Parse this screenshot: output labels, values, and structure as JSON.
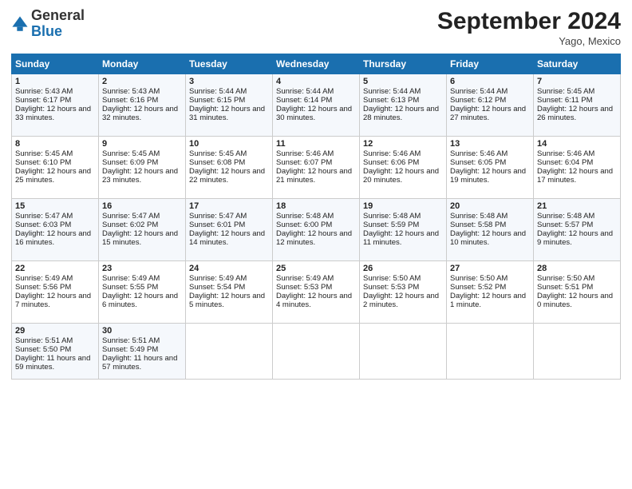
{
  "logo": {
    "general": "General",
    "blue": "Blue"
  },
  "title": "September 2024",
  "location": "Yago, Mexico",
  "days_header": [
    "Sunday",
    "Monday",
    "Tuesday",
    "Wednesday",
    "Thursday",
    "Friday",
    "Saturday"
  ],
  "weeks": [
    [
      {
        "day": "1",
        "info": "Sunrise: 5:43 AM\nSunset: 6:17 PM\nDaylight: 12 hours and 33 minutes."
      },
      {
        "day": "2",
        "info": "Sunrise: 5:43 AM\nSunset: 6:16 PM\nDaylight: 12 hours and 32 minutes."
      },
      {
        "day": "3",
        "info": "Sunrise: 5:44 AM\nSunset: 6:15 PM\nDaylight: 12 hours and 31 minutes."
      },
      {
        "day": "4",
        "info": "Sunrise: 5:44 AM\nSunset: 6:14 PM\nDaylight: 12 hours and 30 minutes."
      },
      {
        "day": "5",
        "info": "Sunrise: 5:44 AM\nSunset: 6:13 PM\nDaylight: 12 hours and 28 minutes."
      },
      {
        "day": "6",
        "info": "Sunrise: 5:44 AM\nSunset: 6:12 PM\nDaylight: 12 hours and 27 minutes."
      },
      {
        "day": "7",
        "info": "Sunrise: 5:45 AM\nSunset: 6:11 PM\nDaylight: 12 hours and 26 minutes."
      }
    ],
    [
      {
        "day": "8",
        "info": "Sunrise: 5:45 AM\nSunset: 6:10 PM\nDaylight: 12 hours and 25 minutes."
      },
      {
        "day": "9",
        "info": "Sunrise: 5:45 AM\nSunset: 6:09 PM\nDaylight: 12 hours and 23 minutes."
      },
      {
        "day": "10",
        "info": "Sunrise: 5:45 AM\nSunset: 6:08 PM\nDaylight: 12 hours and 22 minutes."
      },
      {
        "day": "11",
        "info": "Sunrise: 5:46 AM\nSunset: 6:07 PM\nDaylight: 12 hours and 21 minutes."
      },
      {
        "day": "12",
        "info": "Sunrise: 5:46 AM\nSunset: 6:06 PM\nDaylight: 12 hours and 20 minutes."
      },
      {
        "day": "13",
        "info": "Sunrise: 5:46 AM\nSunset: 6:05 PM\nDaylight: 12 hours and 19 minutes."
      },
      {
        "day": "14",
        "info": "Sunrise: 5:46 AM\nSunset: 6:04 PM\nDaylight: 12 hours and 17 minutes."
      }
    ],
    [
      {
        "day": "15",
        "info": "Sunrise: 5:47 AM\nSunset: 6:03 PM\nDaylight: 12 hours and 16 minutes."
      },
      {
        "day": "16",
        "info": "Sunrise: 5:47 AM\nSunset: 6:02 PM\nDaylight: 12 hours and 15 minutes."
      },
      {
        "day": "17",
        "info": "Sunrise: 5:47 AM\nSunset: 6:01 PM\nDaylight: 12 hours and 14 minutes."
      },
      {
        "day": "18",
        "info": "Sunrise: 5:48 AM\nSunset: 6:00 PM\nDaylight: 12 hours and 12 minutes."
      },
      {
        "day": "19",
        "info": "Sunrise: 5:48 AM\nSunset: 5:59 PM\nDaylight: 12 hours and 11 minutes."
      },
      {
        "day": "20",
        "info": "Sunrise: 5:48 AM\nSunset: 5:58 PM\nDaylight: 12 hours and 10 minutes."
      },
      {
        "day": "21",
        "info": "Sunrise: 5:48 AM\nSunset: 5:57 PM\nDaylight: 12 hours and 9 minutes."
      }
    ],
    [
      {
        "day": "22",
        "info": "Sunrise: 5:49 AM\nSunset: 5:56 PM\nDaylight: 12 hours and 7 minutes."
      },
      {
        "day": "23",
        "info": "Sunrise: 5:49 AM\nSunset: 5:55 PM\nDaylight: 12 hours and 6 minutes."
      },
      {
        "day": "24",
        "info": "Sunrise: 5:49 AM\nSunset: 5:54 PM\nDaylight: 12 hours and 5 minutes."
      },
      {
        "day": "25",
        "info": "Sunrise: 5:49 AM\nSunset: 5:53 PM\nDaylight: 12 hours and 4 minutes."
      },
      {
        "day": "26",
        "info": "Sunrise: 5:50 AM\nSunset: 5:53 PM\nDaylight: 12 hours and 2 minutes."
      },
      {
        "day": "27",
        "info": "Sunrise: 5:50 AM\nSunset: 5:52 PM\nDaylight: 12 hours and 1 minute."
      },
      {
        "day": "28",
        "info": "Sunrise: 5:50 AM\nSunset: 5:51 PM\nDaylight: 12 hours and 0 minutes."
      }
    ],
    [
      {
        "day": "29",
        "info": "Sunrise: 5:51 AM\nSunset: 5:50 PM\nDaylight: 11 hours and 59 minutes."
      },
      {
        "day": "30",
        "info": "Sunrise: 5:51 AM\nSunset: 5:49 PM\nDaylight: 11 hours and 57 minutes."
      },
      {
        "day": "",
        "info": ""
      },
      {
        "day": "",
        "info": ""
      },
      {
        "day": "",
        "info": ""
      },
      {
        "day": "",
        "info": ""
      },
      {
        "day": "",
        "info": ""
      }
    ]
  ]
}
